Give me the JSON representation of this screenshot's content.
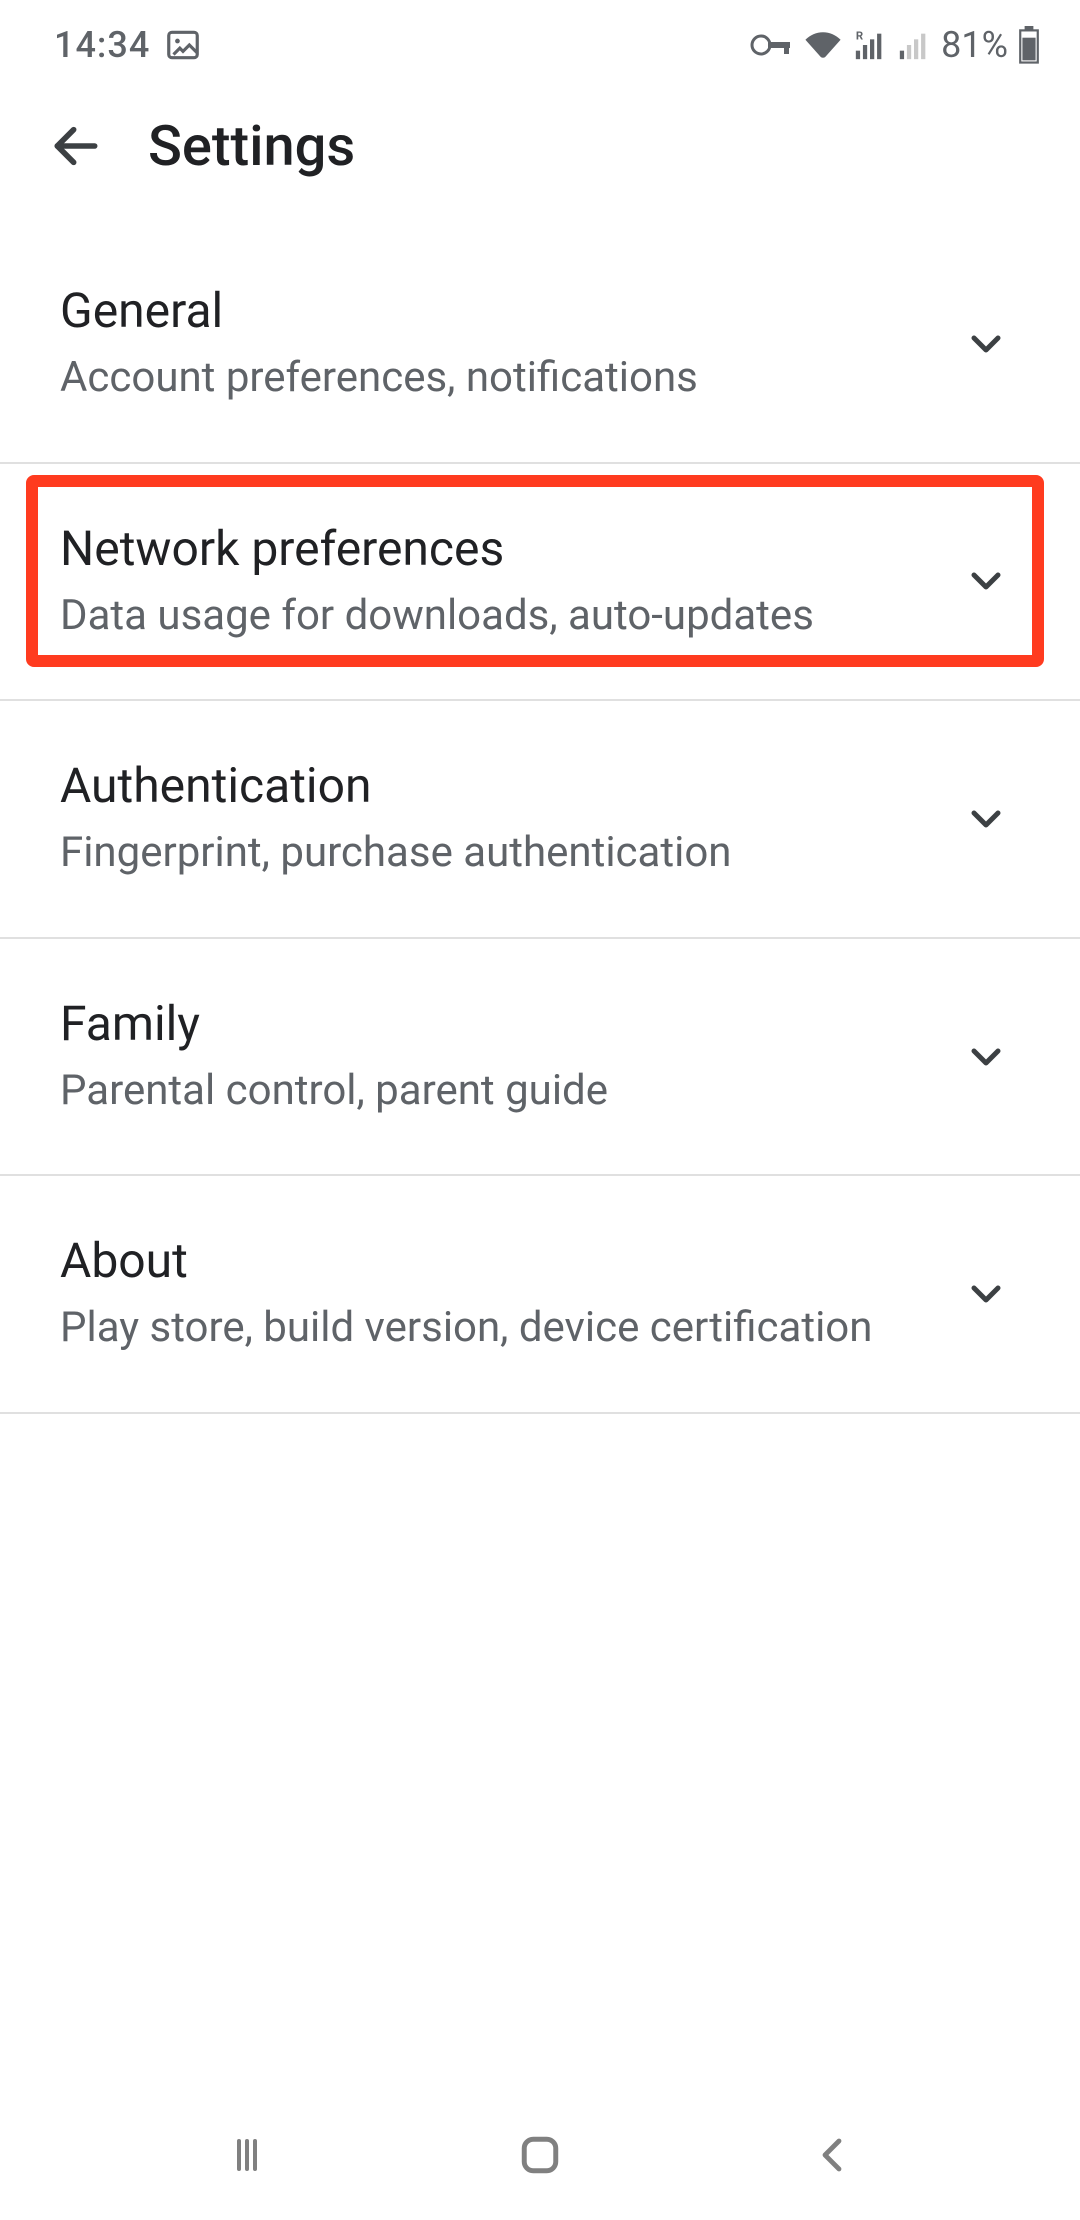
{
  "status": {
    "time": "14:34",
    "battery_pct": "81%"
  },
  "header": {
    "title": "Settings"
  },
  "items": [
    {
      "title": "General",
      "sub": "Account preferences, notifications"
    },
    {
      "title": "Network preferences",
      "sub": "Data usage for downloads, auto-updates"
    },
    {
      "title": "Authentication",
      "sub": "Fingerprint, purchase authentication"
    },
    {
      "title": "Family",
      "sub": "Parental control, parent guide"
    },
    {
      "title": "About",
      "sub": "Play store, build version, device certification"
    }
  ],
  "highlighted_index": 1
}
